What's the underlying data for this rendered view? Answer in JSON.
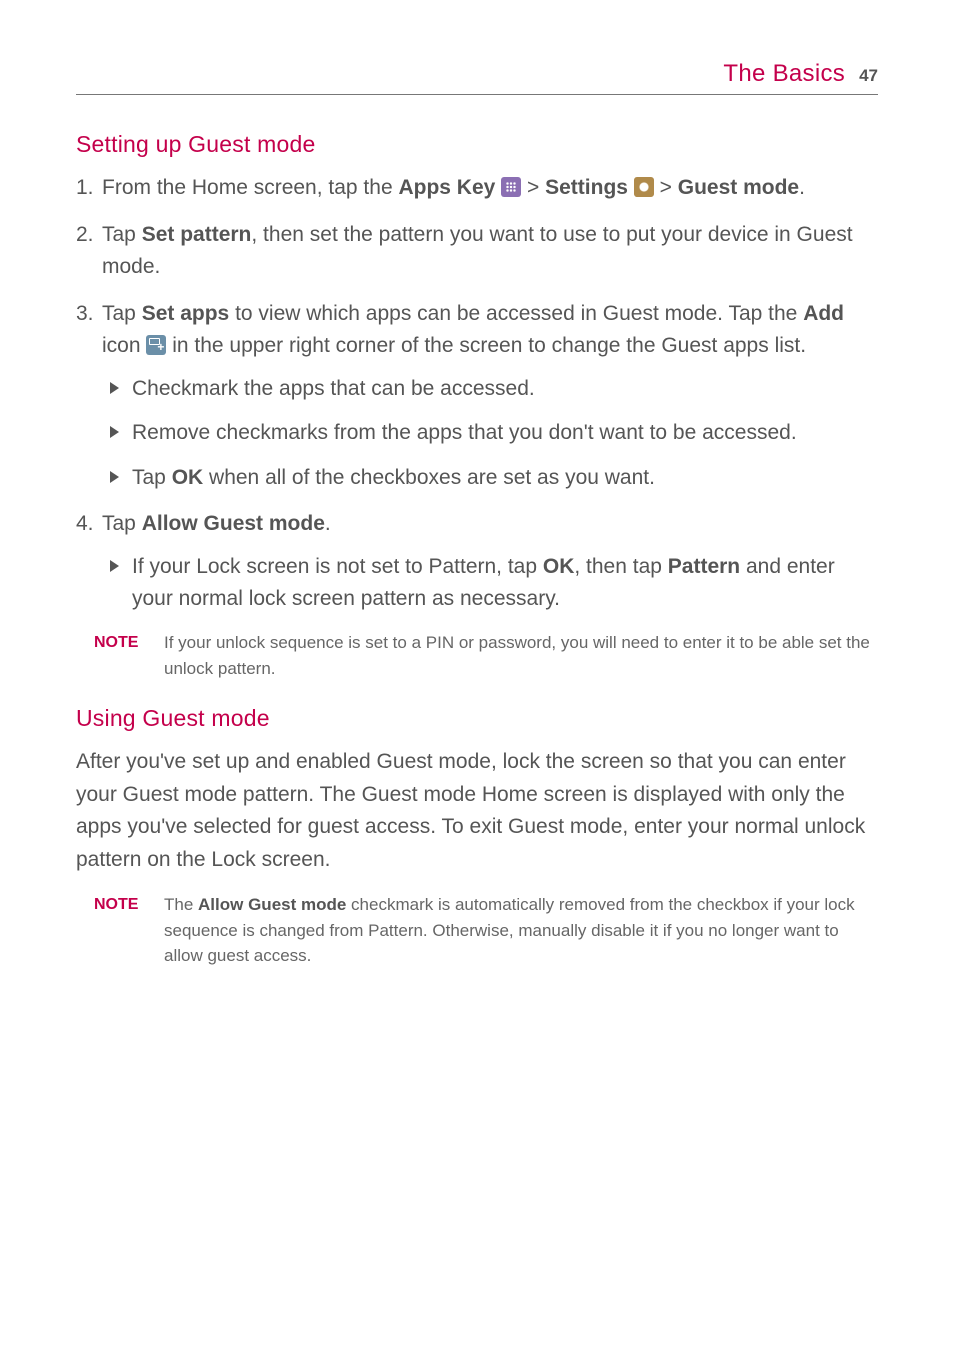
{
  "header": {
    "title": "The Basics",
    "page": "47"
  },
  "section1": {
    "heading": "Setting up Guest mode",
    "step1": {
      "n": "1.",
      "pre": " From the Home screen, tap the ",
      "appsKey": "Apps Key",
      "gt1": " > ",
      "settings": "Settings",
      "gt2": " > ",
      "guestMode": "Guest mode",
      "end": "."
    },
    "step2": {
      "n": "2.",
      "pre": " Tap ",
      "setPattern": "Set pattern",
      "post": ", then set the pattern you want to use to put your device in Guest mode."
    },
    "step3": {
      "n": "3.",
      "pre": " Tap ",
      "setApps": "Set apps",
      "mid1": " to view which apps can be accessed in Guest mode. Tap the ",
      "add": "Add",
      "mid2": " icon ",
      "post": " in the upper right corner of the screen to change the Guest apps list.",
      "sub1": "Checkmark the apps that can be accessed.",
      "sub2": "Remove checkmarks from the apps that you don't want to be accessed.",
      "sub3_pre": "Tap ",
      "sub3_ok": "OK",
      "sub3_post": " when all of the checkboxes are set as you want."
    },
    "step4": {
      "n": "4.",
      "pre": " Tap ",
      "allow": "Allow Guest mode",
      "end": ".",
      "sub1_pre": "If your Lock screen is not set to Pattern, tap ",
      "sub1_ok": "OK",
      "sub1_mid": ", then tap ",
      "sub1_pattern": "Pattern",
      "sub1_post": " and enter your normal lock screen pattern as necessary."
    },
    "note1": {
      "label": "NOTE",
      "text": "If your unlock sequence is set to a PIN or password, you will need to enter it to be able set the unlock pattern."
    }
  },
  "section2": {
    "heading": "Using Guest mode",
    "para": "After you've set up and enabled Guest mode, lock the screen so that you can enter your Guest mode pattern. The Guest mode Home screen is displayed with only the apps you've selected for guest access. To exit Guest mode, enter your normal unlock pattern on the Lock screen.",
    "note2": {
      "label": "NOTE",
      "pre": "The ",
      "bold": "Allow Guest mode",
      "post": " checkmark is automatically removed from the checkbox if your lock sequence is changed from Pattern. Otherwise, manually disable it if you no longer want to allow guest access."
    }
  }
}
